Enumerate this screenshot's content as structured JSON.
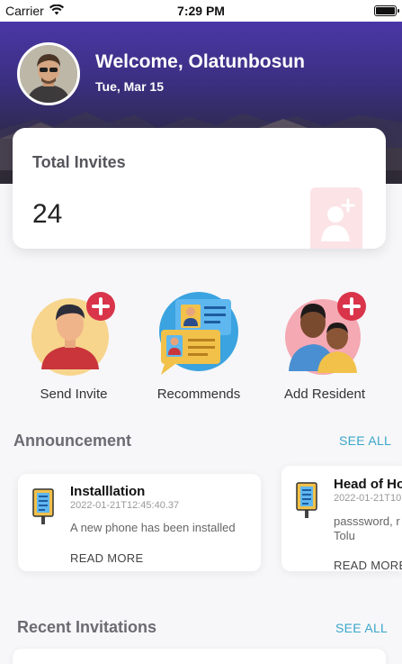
{
  "status_bar": {
    "carrier": "Carrier",
    "time": "7:29 PM"
  },
  "header": {
    "welcome": "Welcome, Olatunbosun",
    "date": "Tue, Mar 15"
  },
  "invites_card": {
    "title": "Total Invites",
    "count": "24"
  },
  "actions": [
    {
      "label": "Send Invite",
      "icon": "send-invite-icon"
    },
    {
      "label": "Recommends",
      "icon": "recommends-icon"
    },
    {
      "label": "Add Resident",
      "icon": "add-resident-icon"
    }
  ],
  "announcement": {
    "title": "Announcement",
    "see_all": "SEE ALL",
    "items": [
      {
        "title": "Installlation",
        "date": "2022-01-21T12:45:40.37",
        "body": "A new phone has been installed",
        "body2": "",
        "read_more": "READ MORE"
      },
      {
        "title": "Head of Ho",
        "date": "2022-01-21T10",
        "body": "passsword, r",
        "body2": "Tolu",
        "read_more": "READ MORE"
      }
    ]
  },
  "recent": {
    "title": "Recent Invitations",
    "see_all": "SEE ALL"
  },
  "colors": {
    "accent": "#3aa6c9",
    "header": "#3b2f80",
    "badge": "#fbe3e6"
  }
}
